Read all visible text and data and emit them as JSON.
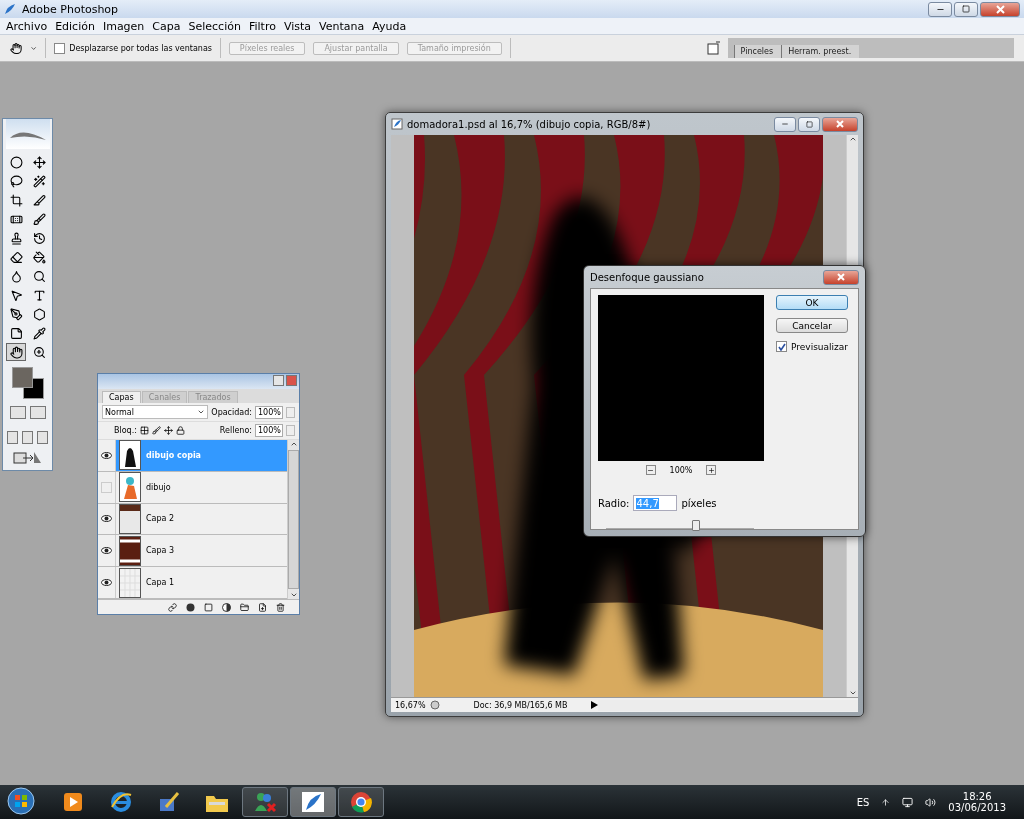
{
  "app": {
    "title": "Adobe Photoshop"
  },
  "menu": [
    "Archivo",
    "Edición",
    "Imagen",
    "Capa",
    "Selección",
    "Filtro",
    "Vista",
    "Ventana",
    "Ayuda"
  ],
  "options_bar": {
    "scroll_all": {
      "label": "Desplazarse por todas las ventanas",
      "checked": false
    },
    "buttons": [
      {
        "label": "Píxeles reales",
        "disabled": true
      },
      {
        "label": "Ajustar pantalla",
        "disabled": true
      },
      {
        "label": "Tamaño impresión",
        "disabled": true
      }
    ],
    "panel_tabs": [
      "Pinceles",
      "Herram. preest."
    ]
  },
  "toolbox": {
    "tools": [
      {
        "kind": "marquee",
        "selected": false
      },
      {
        "kind": "move",
        "selected": false
      },
      {
        "kind": "lasso",
        "selected": false
      },
      {
        "kind": "wand",
        "selected": false
      },
      {
        "kind": "crop",
        "selected": false
      },
      {
        "kind": "slice",
        "selected": false
      },
      {
        "kind": "healing",
        "selected": false
      },
      {
        "kind": "brush",
        "selected": false
      },
      {
        "kind": "stamp",
        "selected": false
      },
      {
        "kind": "history",
        "selected": false
      },
      {
        "kind": "eraser",
        "selected": false
      },
      {
        "kind": "bucket",
        "selected": false
      },
      {
        "kind": "blur",
        "selected": false
      },
      {
        "kind": "dodge",
        "selected": false
      },
      {
        "kind": "select",
        "selected": false
      },
      {
        "kind": "type",
        "selected": false
      },
      {
        "kind": "pen",
        "selected": false
      },
      {
        "kind": "shape",
        "selected": false
      },
      {
        "kind": "notes",
        "selected": false
      },
      {
        "kind": "eyedropper",
        "selected": false
      },
      {
        "kind": "hand",
        "selected": true
      },
      {
        "kind": "zoom",
        "selected": false
      }
    ]
  },
  "layers_panel": {
    "tabs": [
      {
        "label": "Capas",
        "selected": true
      },
      {
        "label": "Canales",
        "selected": false
      },
      {
        "label": "Trazados",
        "selected": false
      }
    ],
    "blend_mode": "Normal",
    "opacity_label": "Opacidad:",
    "opacity": "100%",
    "lock_label": "Bloq.:",
    "fill_label": "Relleno:",
    "fill": "100%",
    "layers": [
      {
        "name": "dibujo copia",
        "visible": true,
        "selected": true,
        "kind": "silhouette"
      },
      {
        "name": "dibujo",
        "visible": false,
        "selected": false,
        "kind": "figure"
      },
      {
        "name": "Capa 2",
        "visible": true,
        "selected": false,
        "kind": "stripe"
      },
      {
        "name": "Capa 3",
        "visible": true,
        "selected": false,
        "kind": "curtain"
      },
      {
        "name": "Capa 1",
        "visible": true,
        "selected": false,
        "kind": "empty"
      }
    ]
  },
  "document": {
    "title": "domadora1.psd al 16,7% (dibujo copia, RGB/8#)",
    "zoom": "16,67%",
    "info": "Doc: 36,9 MB/165,6 MB"
  },
  "dialog": {
    "title": "Desenfoque gaussiano",
    "buttons": [
      {
        "label": "OK",
        "default": true
      },
      {
        "label": "Cancelar",
        "default": false
      }
    ],
    "preview": {
      "label": "Previsualizar",
      "checked": true
    },
    "zoom": "100%",
    "radius_label": "Radio:",
    "radius": "44,7",
    "unit": "píxeles",
    "slider": {
      "level": 0.6
    }
  },
  "taskbar": {
    "apps": [
      {
        "kind": "media",
        "open": false,
        "selected": false
      },
      {
        "kind": "browser",
        "open": false,
        "selected": false
      },
      {
        "kind": "painter",
        "open": false,
        "selected": false
      },
      {
        "kind": "folder",
        "open": false,
        "selected": false
      },
      {
        "kind": "people",
        "open": true,
        "selected": false
      },
      {
        "kind": "feather",
        "open": true,
        "selected": true
      },
      {
        "kind": "chrome",
        "open": true,
        "selected": false
      }
    ],
    "language": "ES",
    "time": "18:26",
    "date": "03/06/2013"
  }
}
